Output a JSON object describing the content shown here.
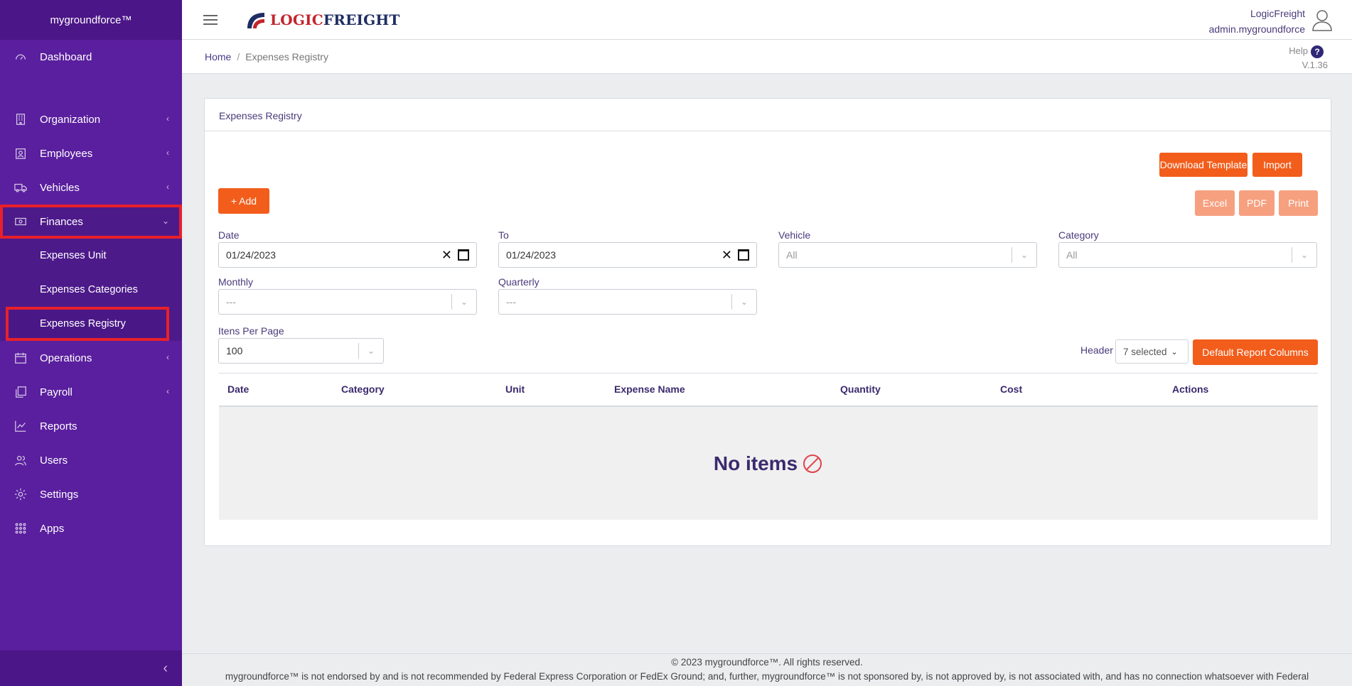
{
  "sidebar": {
    "brand": "mygroundforce™",
    "items": [
      {
        "label": "Dashboard"
      },
      {
        "label": "Organization"
      },
      {
        "label": "Employees"
      },
      {
        "label": "Vehicles"
      },
      {
        "label": "Finances"
      },
      {
        "label": "Operations"
      },
      {
        "label": "Payroll"
      },
      {
        "label": "Reports"
      },
      {
        "label": "Users"
      },
      {
        "label": "Settings"
      },
      {
        "label": "Apps"
      }
    ],
    "finances_sub": [
      {
        "label": "Expenses Unit"
      },
      {
        "label": "Expenses Categories"
      },
      {
        "label": "Expenses Registry"
      }
    ],
    "collapse_glyph": "‹"
  },
  "header": {
    "logo_a": "LOGIC",
    "logo_b": "FREIGHT",
    "company": "LogicFreight",
    "username": "admin.mygroundforce"
  },
  "subheader": {
    "breadcrumb_home": "Home",
    "breadcrumb_sep": "/",
    "breadcrumb_current": "Expenses Registry",
    "help": "Help",
    "help_glyph": "?",
    "version": "V.1.36"
  },
  "card": {
    "title": "Expenses Registry",
    "download_template": "Download Template",
    "import": "Import",
    "add": "+ Add",
    "excel": "Excel",
    "pdf": "PDF",
    "print": "Print"
  },
  "filters": {
    "date_label": "Date",
    "date_value": "01/24/2023",
    "to_label": "To",
    "to_value": "01/24/2023",
    "vehicle_label": "Vehicle",
    "vehicle_value": "All",
    "category_label": "Category",
    "category_value": "All",
    "monthly_label": "Monthly",
    "monthly_value": "---",
    "quarterly_label": "Quarterly",
    "quarterly_value": "---",
    "items_label": "Itens Per Page",
    "items_value": "100",
    "header_label": "Header",
    "header_value": "7 selected",
    "default_columns": "Default Report Columns"
  },
  "table": {
    "columns": [
      "Date",
      "Category",
      "Unit",
      "Expense Name",
      "Quantity",
      "Cost",
      "Actions"
    ],
    "empty_text": "No items"
  },
  "footer": {
    "copyright": "© 2023 mygroundforce™. All rights reserved.",
    "disclaimer": "mygroundforce™ is not endorsed by and is not recommended by Federal Express Corporation or FedEx Ground; and, further, mygroundforce™ is not sponsored by, is not approved by, is not associated with, and has no connection whatsoever with Federal"
  },
  "colors": {
    "sidebar": "#5a1f9e",
    "accent": "#f25d1b",
    "highlight": "#e8202a"
  }
}
